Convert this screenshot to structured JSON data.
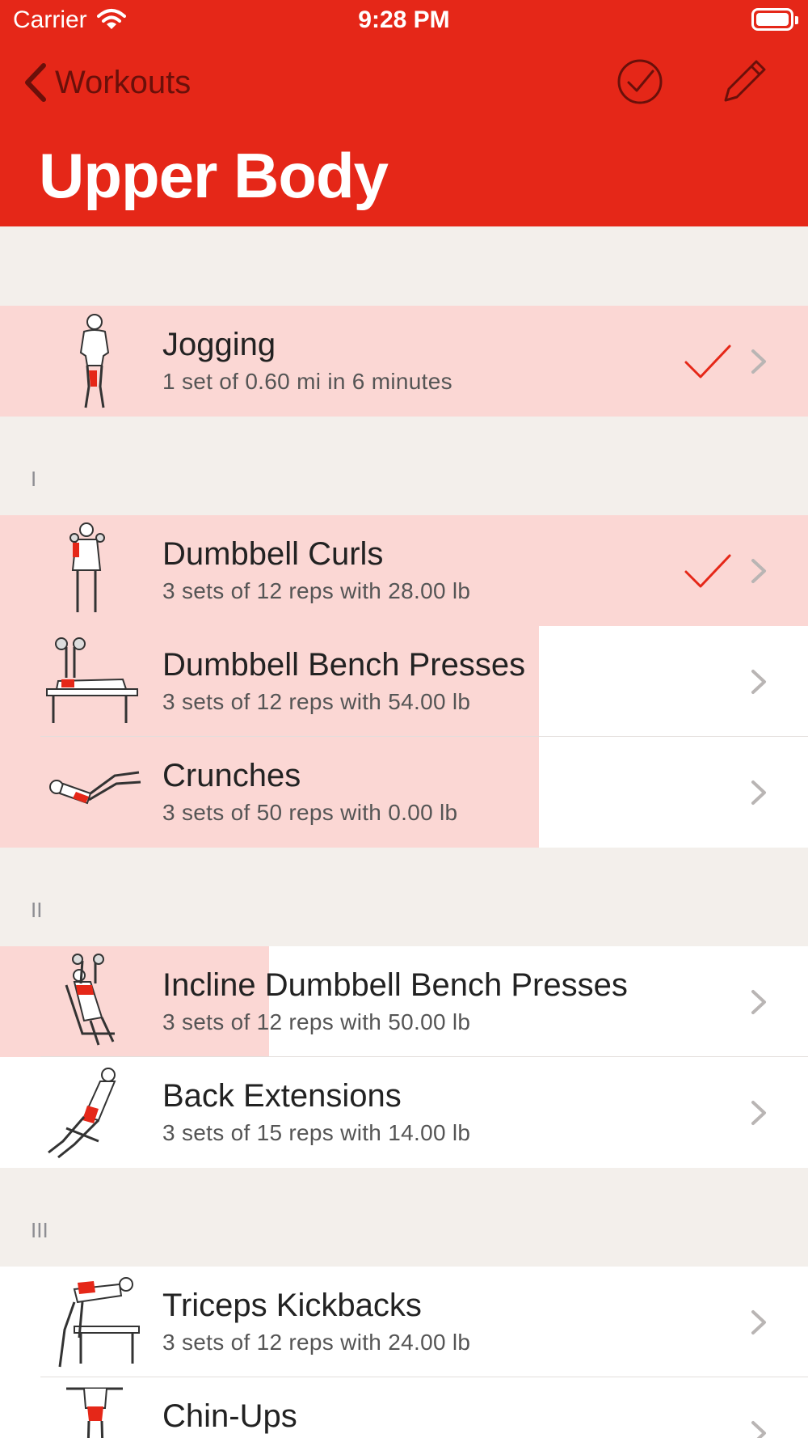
{
  "status_bar": {
    "carrier": "Carrier",
    "time": "9:28 PM"
  },
  "nav": {
    "back_label": "Workouts",
    "title": "Upper Body"
  },
  "sections": [
    {
      "label": ""
    },
    {
      "label": "I"
    },
    {
      "label": "II"
    },
    {
      "label": "III"
    }
  ],
  "exercises": [
    {
      "name": "Jogging",
      "detail": "1 set of 0.60 mi in 6 minutes",
      "completed": true,
      "progress": 1.0
    },
    {
      "name": "Dumbbell Curls",
      "detail": "3 sets of 12 reps with 28.00 lb",
      "completed": true,
      "progress": 1.0
    },
    {
      "name": "Dumbbell Bench Presses",
      "detail": "3 sets of 12 reps with 54.00 lb",
      "completed": false,
      "progress": 0.667
    },
    {
      "name": "Crunches",
      "detail": "3 sets of 50 reps with 0.00 lb",
      "completed": false,
      "progress": 0.667
    },
    {
      "name": "Incline Dumbbell Bench Presses",
      "detail": "3 sets of 12 reps with 50.00 lb",
      "completed": false,
      "progress": 0.333
    },
    {
      "name": "Back Extensions",
      "detail": "3 sets of 15 reps with 14.00 lb",
      "completed": false,
      "progress": 0
    },
    {
      "name": "Triceps Kickbacks",
      "detail": "3 sets of 12 reps with 24.00 lb",
      "completed": false,
      "progress": 0
    },
    {
      "name": "Chin-Ups",
      "detail": "",
      "completed": false,
      "progress": 0
    }
  ],
  "colors": {
    "accent": "#e52718",
    "progress_fill": "#fbd7d4",
    "background": "#f3efeb"
  }
}
